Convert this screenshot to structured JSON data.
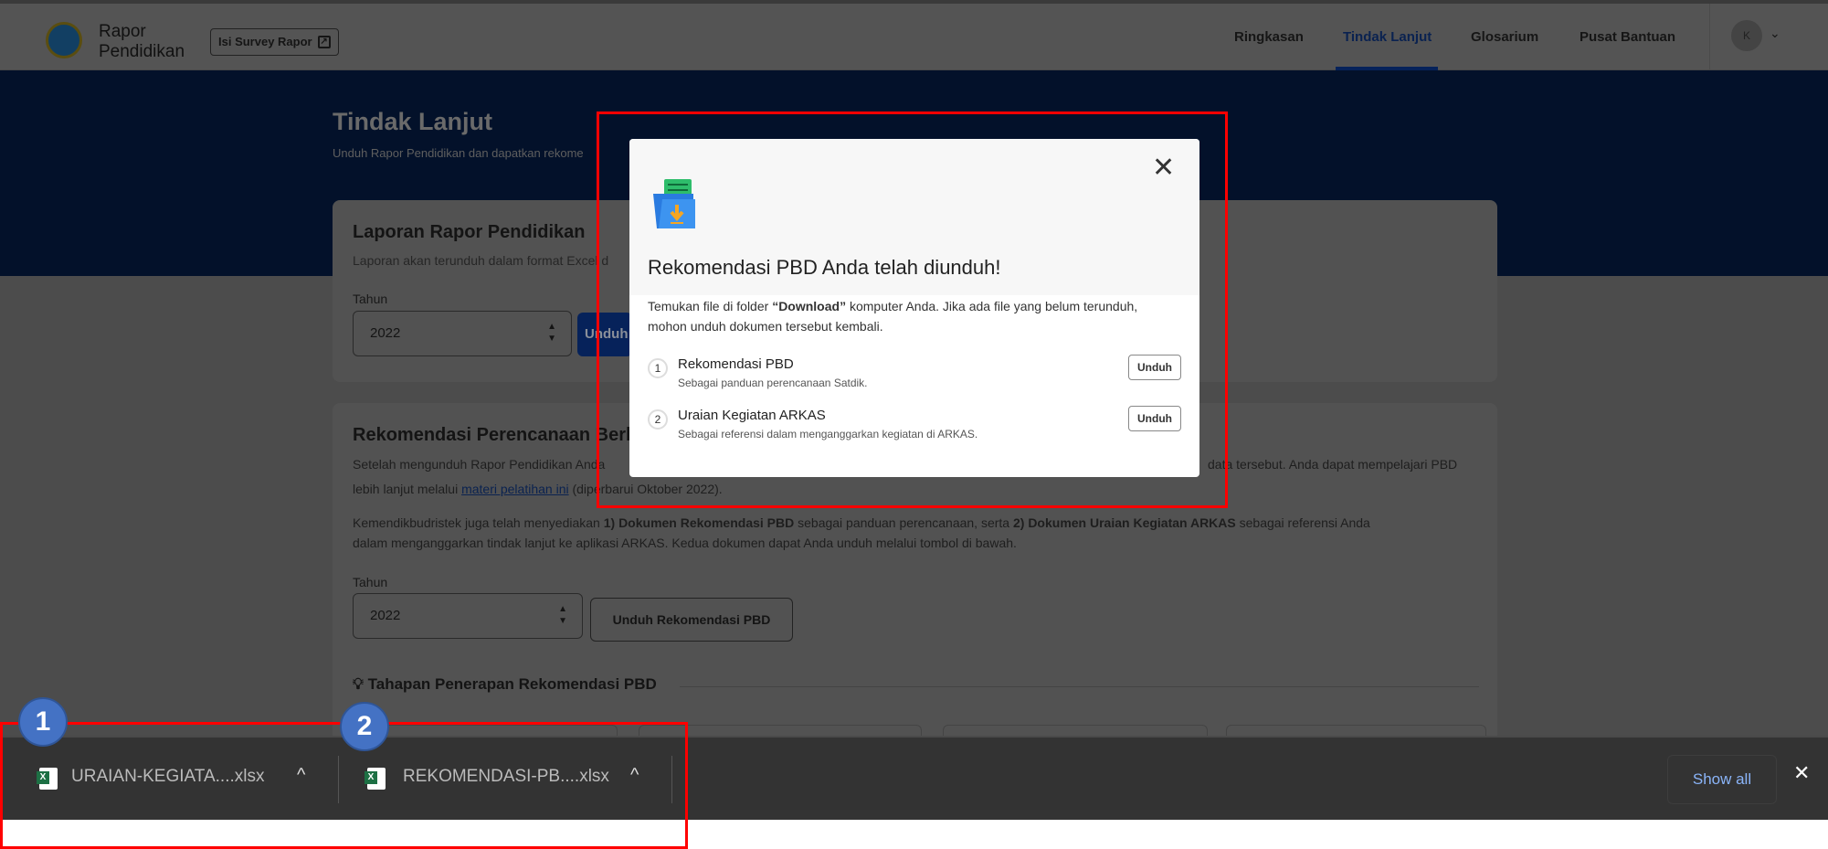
{
  "header": {
    "brand_line1": "Rapor",
    "brand_line2": "Pendidikan",
    "survey_label": "Isi Survey Rapor",
    "nav": [
      "Ringkasan",
      "Tindak Lanjut",
      "Glosarium",
      "Pusat Bantuan"
    ],
    "active_nav": "Tindak Lanjut",
    "avatar_initial": "K"
  },
  "page": {
    "title": "Tindak Lanjut",
    "subtitle": "Unduh Rapor Pendidikan dan dapatkan rekome",
    "card1": {
      "title": "Laporan Rapor Pendidikan",
      "subtitle": "Laporan akan terunduh dalam format Excel d",
      "year_label": "Tahun",
      "year_value": "2022",
      "button_label": "Unduh"
    },
    "card2": {
      "title": "Rekomendasi Perencanaan Berb",
      "para1_a": "Setelah mengunduh Rapor Pendidikan Anda",
      "para1_b": "data tersebut. Anda dapat mempelajari PBD",
      "para1_c": "lebih lanjut melalui",
      "link": "materi pelatihan ini",
      "para1_d": " (diperbarui Oktober 2022).",
      "para2_a": "Kemendikbudristek juga telah menyediakan ",
      "para2_b": "1) Dokumen Rekomendasi PBD",
      "para2_c": " sebagai panduan perencanaan, serta ",
      "para2_d": "2) Dokumen Uraian Kegiatan ARKAS",
      "para2_e": " sebagai referensi Anda",
      "para2_f": "dalam menganggarkan tindak lanjut ke aplikasi ARKAS. Kedua dokumen dapat Anda unduh melalui tombol di bawah.",
      "year_label": "Tahun",
      "year_value": "2022",
      "button_label": "Unduh Rekomendasi PBD",
      "steps_title": "Tahapan Penerapan Rekomendasi PBD"
    }
  },
  "modal": {
    "title": "Rekomendasi PBD Anda telah diunduh!",
    "desc_a": "Temukan file di folder ",
    "desc_bold": "“Download”",
    "desc_b": " komputer Anda. Jika ada file yang belum terunduh, mohon unduh dokumen tersebut kembali.",
    "items": [
      {
        "num": "1",
        "title": "Rekomendasi PBD",
        "subtitle": "Sebagai panduan perencanaan Satdik.",
        "button": "Unduh"
      },
      {
        "num": "2",
        "title": "Uraian Kegiatan ARKAS",
        "subtitle": "Sebagai referensi dalam menganggarkan kegiatan di ARKAS.",
        "button": "Unduh"
      }
    ]
  },
  "downloads": {
    "files": [
      {
        "name": "URAIAN-KEGIATA....xlsx",
        "icon": "excel-file-icon"
      },
      {
        "name": "REKOMENDASI-PB....xlsx",
        "icon": "excel-file-icon"
      }
    ],
    "show_all": "Show all"
  },
  "annotations": {
    "badges": [
      "1",
      "2"
    ],
    "highlight_color": "#ff0000",
    "badge_color": "#4472c4"
  }
}
